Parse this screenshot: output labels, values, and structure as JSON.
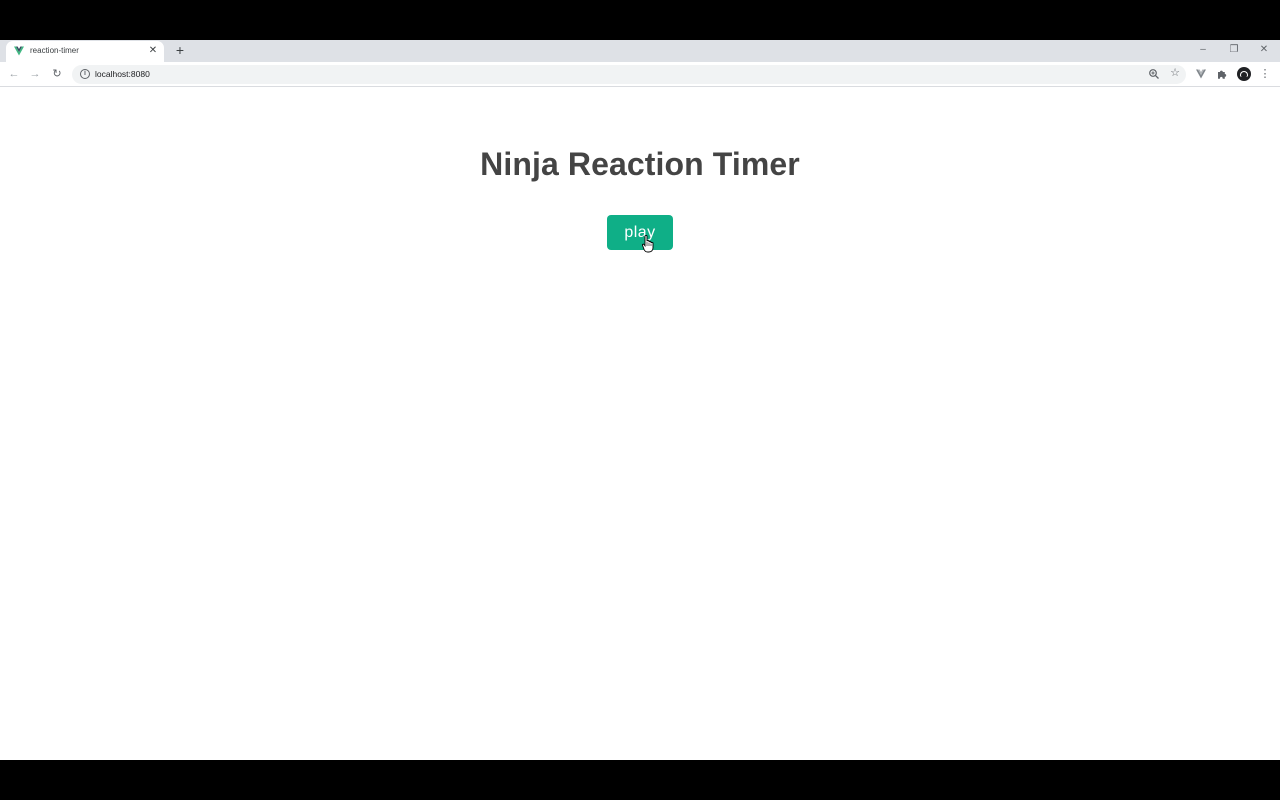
{
  "browser": {
    "tab": {
      "title": "reaction-timer",
      "favicon": "vue-logo-icon"
    },
    "new_tab_label": "+",
    "address": {
      "url": "localhost:8080"
    },
    "colors": {
      "tabstrip": "#dee1e6",
      "omnibox": "#f1f3f4"
    }
  },
  "page": {
    "title": "Ninja Reaction Timer",
    "play_label": "play",
    "colors": {
      "button": "#0faf87",
      "title": "#444444",
      "background": "#ffffff"
    }
  }
}
